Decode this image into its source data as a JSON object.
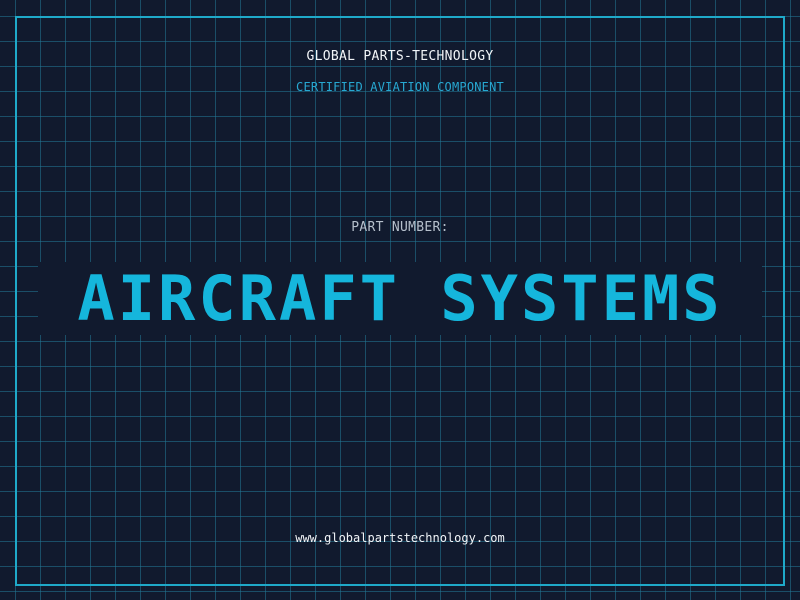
{
  "header": {
    "company": "GLOBAL PARTS-TECHNOLOGY",
    "subtitle": "CERTIFIED AVIATION COMPONENT"
  },
  "main": {
    "part_label": "PART NUMBER:",
    "title": "AIRCRAFT SYSTEMS"
  },
  "footer": {
    "website": "www.globalpartstechnology.com"
  },
  "colors": {
    "background": "#111a2e",
    "grid": "#227896",
    "frame": "#1fa9c9",
    "accent": "#15b6dc",
    "text": "#f2f5f8"
  }
}
